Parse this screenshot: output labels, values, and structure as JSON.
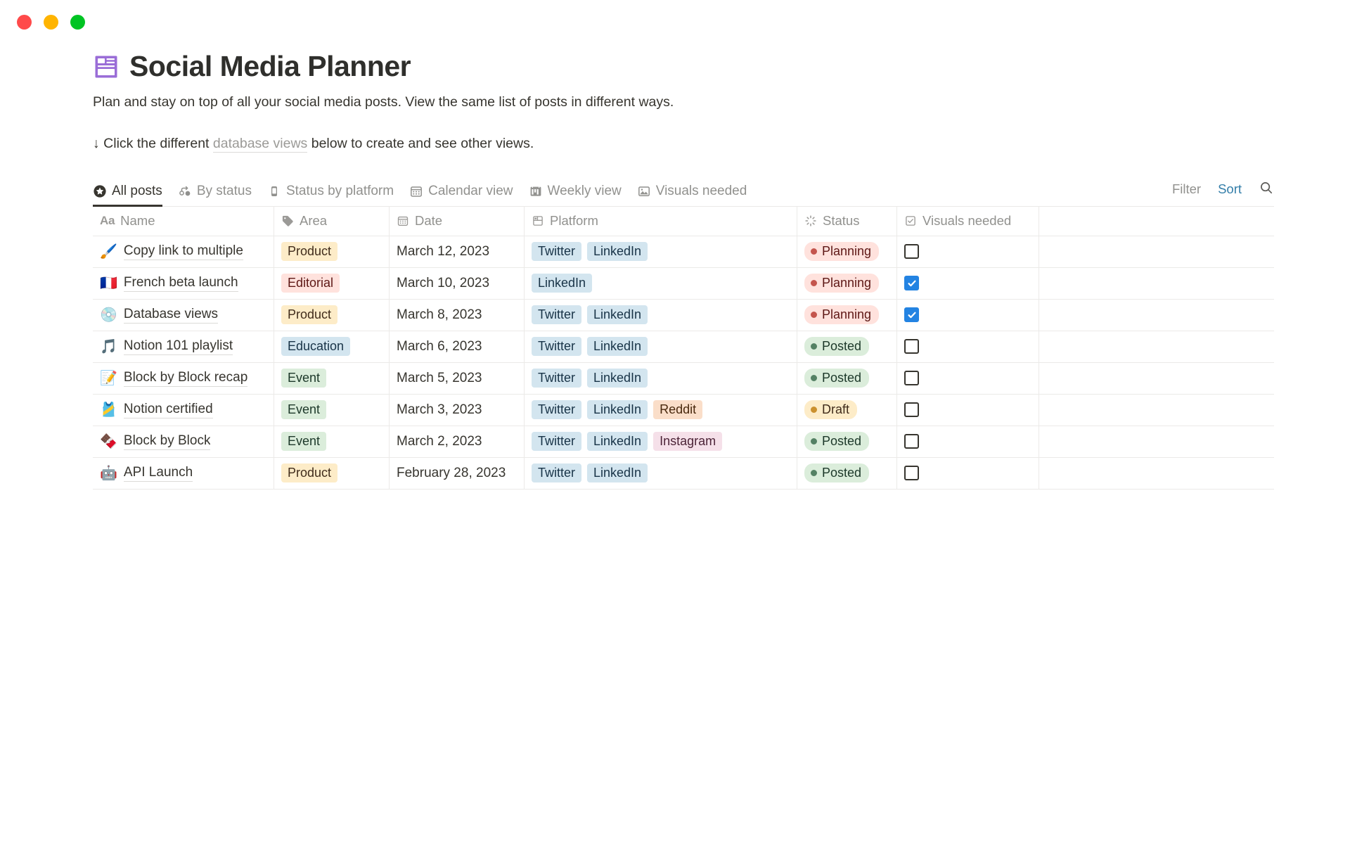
{
  "window": {
    "controls": [
      {
        "name": "close",
        "color": "#ff4a4a"
      },
      {
        "name": "minimize",
        "color": "#ffb400"
      },
      {
        "name": "maximize",
        "color": "#00c423"
      }
    ]
  },
  "header": {
    "icon": "database-layout-icon",
    "icon_color": "#9a6dd7",
    "title": "Social Media Planner",
    "subtitle": "Plan and stay on top of all your social media posts. View the same list of posts in different ways.",
    "hint_prefix": "↓ Click the different ",
    "hint_link": "database views",
    "hint_suffix": " below to create and see other views."
  },
  "views": {
    "tabs": [
      {
        "label": "All posts",
        "icon": "star-circle-icon",
        "active": true
      },
      {
        "label": "By status",
        "icon": "board-group-icon",
        "active": false
      },
      {
        "label": "Status by platform",
        "icon": "mobile-board-icon",
        "active": false
      },
      {
        "label": "Calendar view",
        "icon": "calendar-icon",
        "active": false
      },
      {
        "label": "Weekly view",
        "icon": "timeline-icon",
        "active": false
      },
      {
        "label": "Visuals needed",
        "icon": "gallery-image-icon",
        "active": false
      }
    ],
    "actions": {
      "filter_label": "Filter",
      "sort_label": "Sort",
      "sort_color": "#337ea9",
      "search_icon": "search-icon"
    }
  },
  "table": {
    "columns": [
      {
        "label": "Name",
        "icon": "text-aa-icon"
      },
      {
        "label": "Area",
        "icon": "tag-icon"
      },
      {
        "label": "Date",
        "icon": "calendar-icon"
      },
      {
        "label": "Platform",
        "icon": "multi-select-icon"
      },
      {
        "label": "Status",
        "icon": "status-spinner-icon"
      },
      {
        "label": "Visuals needed",
        "icon": "checkbox-icon"
      }
    ],
    "rows": [
      {
        "emoji": "🖌️",
        "emoji_name": "paintbrush-emoji",
        "name": "Copy link to multiple",
        "area": "Product",
        "date": "March 12, 2023",
        "platforms": [
          "Twitter",
          "LinkedIn"
        ],
        "status": "Planning",
        "visuals_needed": false
      },
      {
        "emoji": "🇫🇷",
        "emoji_name": "france-flag-emoji",
        "name": "French beta launch",
        "area": "Editorial",
        "date": "March 10, 2023",
        "platforms": [
          "LinkedIn"
        ],
        "status": "Planning",
        "visuals_needed": true
      },
      {
        "emoji": "💿",
        "emoji_name": "optical-disk-emoji",
        "name": "Database views",
        "area": "Product",
        "date": "March 8, 2023",
        "platforms": [
          "Twitter",
          "LinkedIn"
        ],
        "status": "Planning",
        "visuals_needed": true
      },
      {
        "emoji": "🎵",
        "emoji_name": "music-note-emoji",
        "name": "Notion 101 playlist",
        "area": "Education",
        "date": "March 6, 2023",
        "platforms": [
          "Twitter",
          "LinkedIn"
        ],
        "status": "Posted",
        "visuals_needed": false
      },
      {
        "emoji": "📝",
        "emoji_name": "memo-emoji",
        "name": "Block by Block recap",
        "area": "Event",
        "date": "March 5, 2023",
        "platforms": [
          "Twitter",
          "LinkedIn"
        ],
        "status": "Posted",
        "visuals_needed": false
      },
      {
        "emoji": "🎽",
        "emoji_name": "running-shirt-emoji",
        "name": "Notion certified",
        "area": "Event",
        "date": "March 3, 2023",
        "platforms": [
          "Twitter",
          "LinkedIn",
          "Reddit"
        ],
        "status": "Draft",
        "visuals_needed": false
      },
      {
        "emoji": "🍫",
        "emoji_name": "chocolate-bar-emoji",
        "name": "Block by Block",
        "area": "Event",
        "date": "March 2, 2023",
        "platforms": [
          "Twitter",
          "LinkedIn",
          "Instagram"
        ],
        "status": "Posted",
        "visuals_needed": false
      },
      {
        "emoji": "🤖",
        "emoji_name": "robot-emoji",
        "name": "API Launch",
        "area": "Product",
        "date": "February 28, 2023",
        "platforms": [
          "Twitter",
          "LinkedIn"
        ],
        "status": "Posted",
        "visuals_needed": false
      }
    ]
  },
  "colors": {
    "area": {
      "Product": {
        "bg": "#FDECC8",
        "fg": "#402C1B"
      },
      "Editorial": {
        "bg": "#FFE2DD",
        "fg": "#5D1715"
      },
      "Education": {
        "bg": "#D3E5EF",
        "fg": "#183347"
      },
      "Event": {
        "bg": "#DBEDDB",
        "fg": "#1C3829"
      }
    },
    "platform": {
      "Twitter": {
        "bg": "#D3E5EF",
        "fg": "#183347"
      },
      "LinkedIn": {
        "bg": "#D3E5EF",
        "fg": "#183347"
      },
      "Reddit": {
        "bg": "#FADEC9",
        "fg": "#49290E"
      },
      "Instagram": {
        "bg": "#F5E0E9",
        "fg": "#4C2337"
      }
    },
    "status": {
      "Planning": {
        "bg": "#FFE2DD",
        "fg": "#5D1715",
        "dot": "#C4554D"
      },
      "Posted": {
        "bg": "#DBEDDB",
        "fg": "#1C3829",
        "dot": "#548164"
      },
      "Draft": {
        "bg": "#FDECC8",
        "fg": "#402C1B",
        "dot": "#CB912F"
      }
    },
    "checkbox_on": "#2383e2"
  }
}
